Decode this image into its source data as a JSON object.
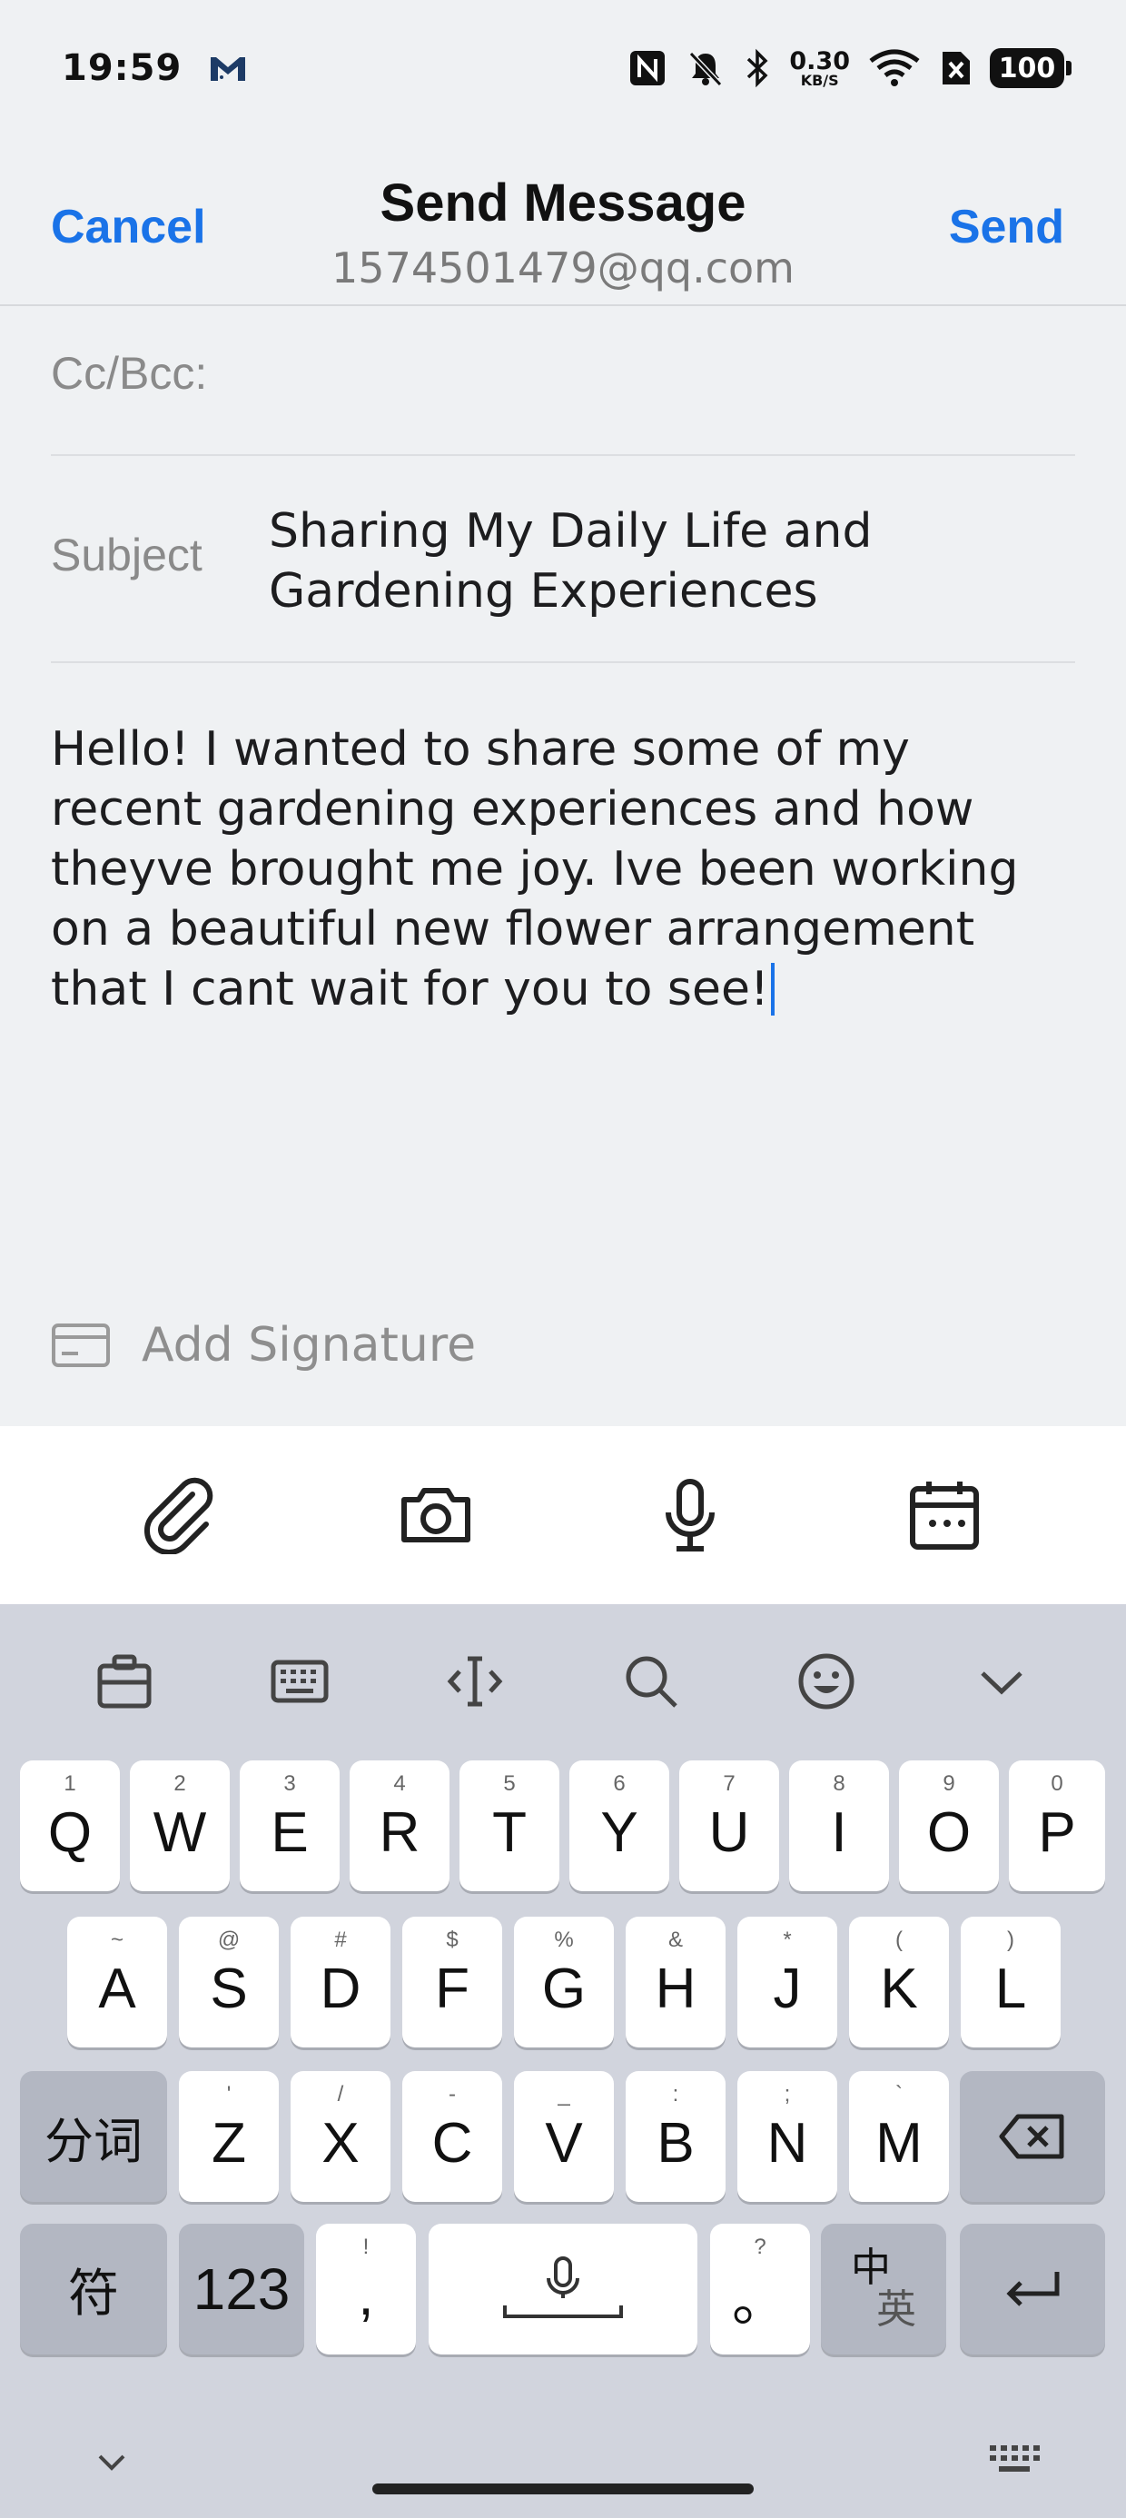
{
  "status_bar": {
    "time": "19:59",
    "net_speed_value": "0.30",
    "net_speed_unit": "KB/S",
    "battery": "100",
    "icons": [
      "gmail-icon",
      "nfc-icon",
      "mute-icon",
      "bluetooth-icon",
      "wifi-icon",
      "sim-blocked-icon",
      "battery-icon"
    ]
  },
  "header": {
    "cancel_label": "Cancel",
    "title": "Send Message",
    "subtitle": "1574501479@qq.com",
    "send_label": "Send"
  },
  "form": {
    "ccbcc_label": "Cc/Bcc:",
    "ccbcc_value": "",
    "subject_label": "Subject",
    "subject_value": "Sharing My Daily Life and Gardening Experiences",
    "body": "Hello! I wanted to share some of my recent gardening experiences and how theyve brought me joy. Ive been working on a beautiful new flower arrangement that I cant wait for you to see!",
    "signature_label": "Add Signature"
  },
  "toolbar": {
    "items": [
      "paperclip-icon",
      "camera-icon",
      "microphone-icon",
      "calendar-icon"
    ]
  },
  "keyboard": {
    "row1": [
      {
        "main": "Q",
        "hint": "1"
      },
      {
        "main": "W",
        "hint": "2"
      },
      {
        "main": "E",
        "hint": "3"
      },
      {
        "main": "R",
        "hint": "4"
      },
      {
        "main": "T",
        "hint": "5"
      },
      {
        "main": "Y",
        "hint": "6"
      },
      {
        "main": "U",
        "hint": "7"
      },
      {
        "main": "I",
        "hint": "8"
      },
      {
        "main": "O",
        "hint": "9"
      },
      {
        "main": "P",
        "hint": "0"
      }
    ],
    "row2": [
      {
        "main": "A",
        "hint": "~"
      },
      {
        "main": "S",
        "hint": "@"
      },
      {
        "main": "D",
        "hint": "#"
      },
      {
        "main": "F",
        "hint": "$"
      },
      {
        "main": "G",
        "hint": "%"
      },
      {
        "main": "H",
        "hint": "&"
      },
      {
        "main": "J",
        "hint": "*"
      },
      {
        "main": "K",
        "hint": "("
      },
      {
        "main": "L",
        "hint": ")"
      }
    ],
    "row3": [
      {
        "main": "Z",
        "hint": "'"
      },
      {
        "main": "X",
        "hint": "/"
      },
      {
        "main": "C",
        "hint": "-"
      },
      {
        "main": "V",
        "hint": "_"
      },
      {
        "main": "B",
        "hint": ":"
      },
      {
        "main": "N",
        "hint": ";"
      },
      {
        "main": "M",
        "hint": "`"
      }
    ],
    "segment_label": "分词",
    "symbol_label": "符",
    "numeric_label": "123",
    "comma_key": {
      "main": ",",
      "hint": "!"
    },
    "period_key": {
      "main": "。",
      "hint": "?"
    },
    "lang_switch": {
      "main": "中",
      "sub": "英"
    }
  }
}
